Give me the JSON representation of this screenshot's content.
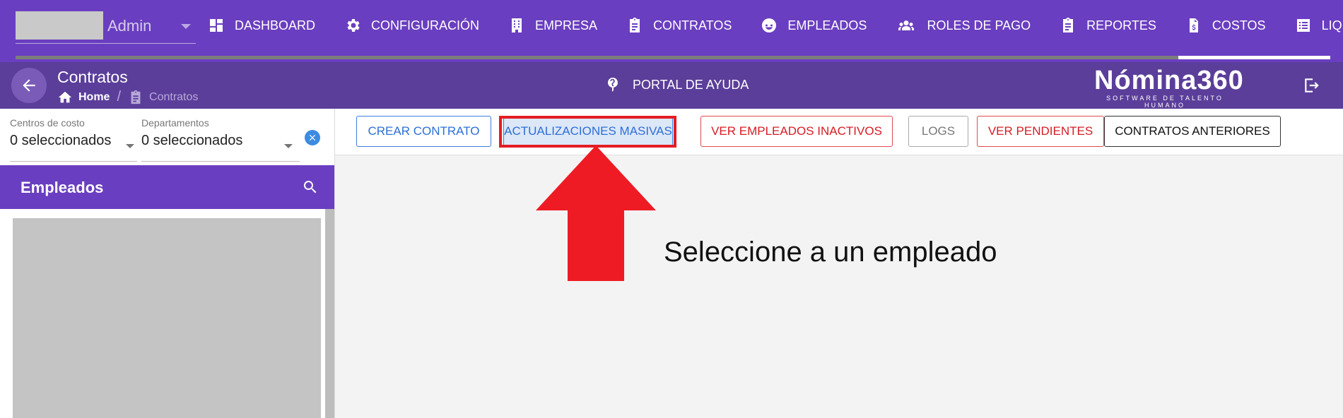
{
  "topnav": {
    "user_name": "Admin",
    "items": [
      {
        "label": "DASHBOARD",
        "icon": "dashboard-icon"
      },
      {
        "label": "CONFIGURACIÓN",
        "icon": "gear-icon"
      },
      {
        "label": "EMPRESA",
        "icon": "building-icon"
      },
      {
        "label": "CONTRATOS",
        "icon": "clipboard-icon"
      },
      {
        "label": "EMPLEADOS",
        "icon": "face-icon"
      },
      {
        "label": "ROLES DE PAGO",
        "icon": "people-icon"
      },
      {
        "label": "REPORTES",
        "icon": "clipboard-icon"
      },
      {
        "label": "COSTOS",
        "icon": "invoice-icon"
      },
      {
        "label": "LIQUIDACIONE",
        "icon": "list-icon"
      }
    ]
  },
  "subheader": {
    "title": "Contratos",
    "breadcrumb_home": "Home",
    "breadcrumb_sep": "/",
    "breadcrumb_current": "Contratos",
    "help_label": "PORTAL DE AYUDA",
    "brand_name": "Nómina360",
    "brand_tagline": "SOFTWARE DE TALENTO HUMANO"
  },
  "filters": {
    "cost_centers_label": "Centros de costo",
    "cost_centers_value": "0 seleccionados",
    "departments_label": "Departamentos",
    "departments_value": "0 seleccionados"
  },
  "employees": {
    "title": "Empleados"
  },
  "toolbar": {
    "crear": "CREAR CONTRATO",
    "masivas": "ACTUALIZACIONES MASIVAS",
    "inactivos": "VER EMPLEADOS INACTIVOS",
    "logs": "LOGS",
    "pendientes": "VER PENDIENTES",
    "anteriores": "CONTRATOS ANTERIORES"
  },
  "main": {
    "empty_message": "Seleccione a un empleado"
  },
  "colors": {
    "primary": "#6a3ec0",
    "subheader": "#5b3e9a",
    "highlight": "#e41c24",
    "blue_button": "#2d6fd6",
    "red_button": "#d61c24"
  }
}
